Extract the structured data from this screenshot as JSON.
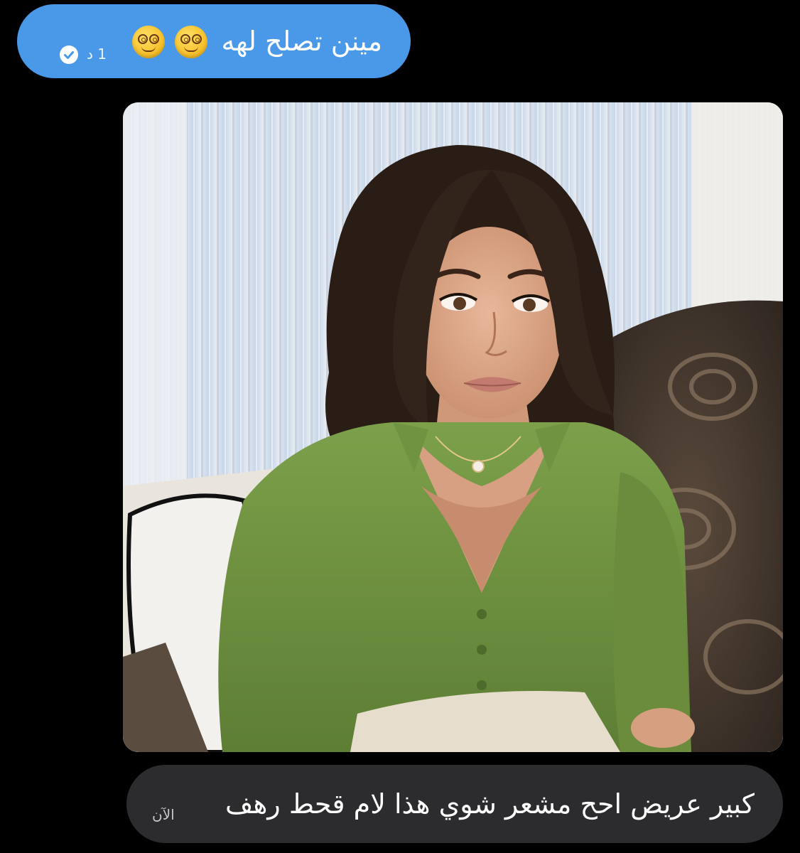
{
  "outgoing_message": {
    "text": "مينن تصلح لهه",
    "emojis": [
      "face-with-spiral-eyes",
      "face-with-spiral-eyes"
    ],
    "time": "1 د",
    "status_icon": "check-circle-icon",
    "bubble_color": "#4a99e9"
  },
  "photo": {
    "subject": "woman-in-green-top-photo"
  },
  "incoming_message": {
    "text": "كبير عريض احح مشعر شوي هذا لام قحط رهف",
    "time": "الآن",
    "bubble_color": "#2c2c2e"
  },
  "colors": {
    "background": "#000000",
    "text": "#ffffff"
  }
}
